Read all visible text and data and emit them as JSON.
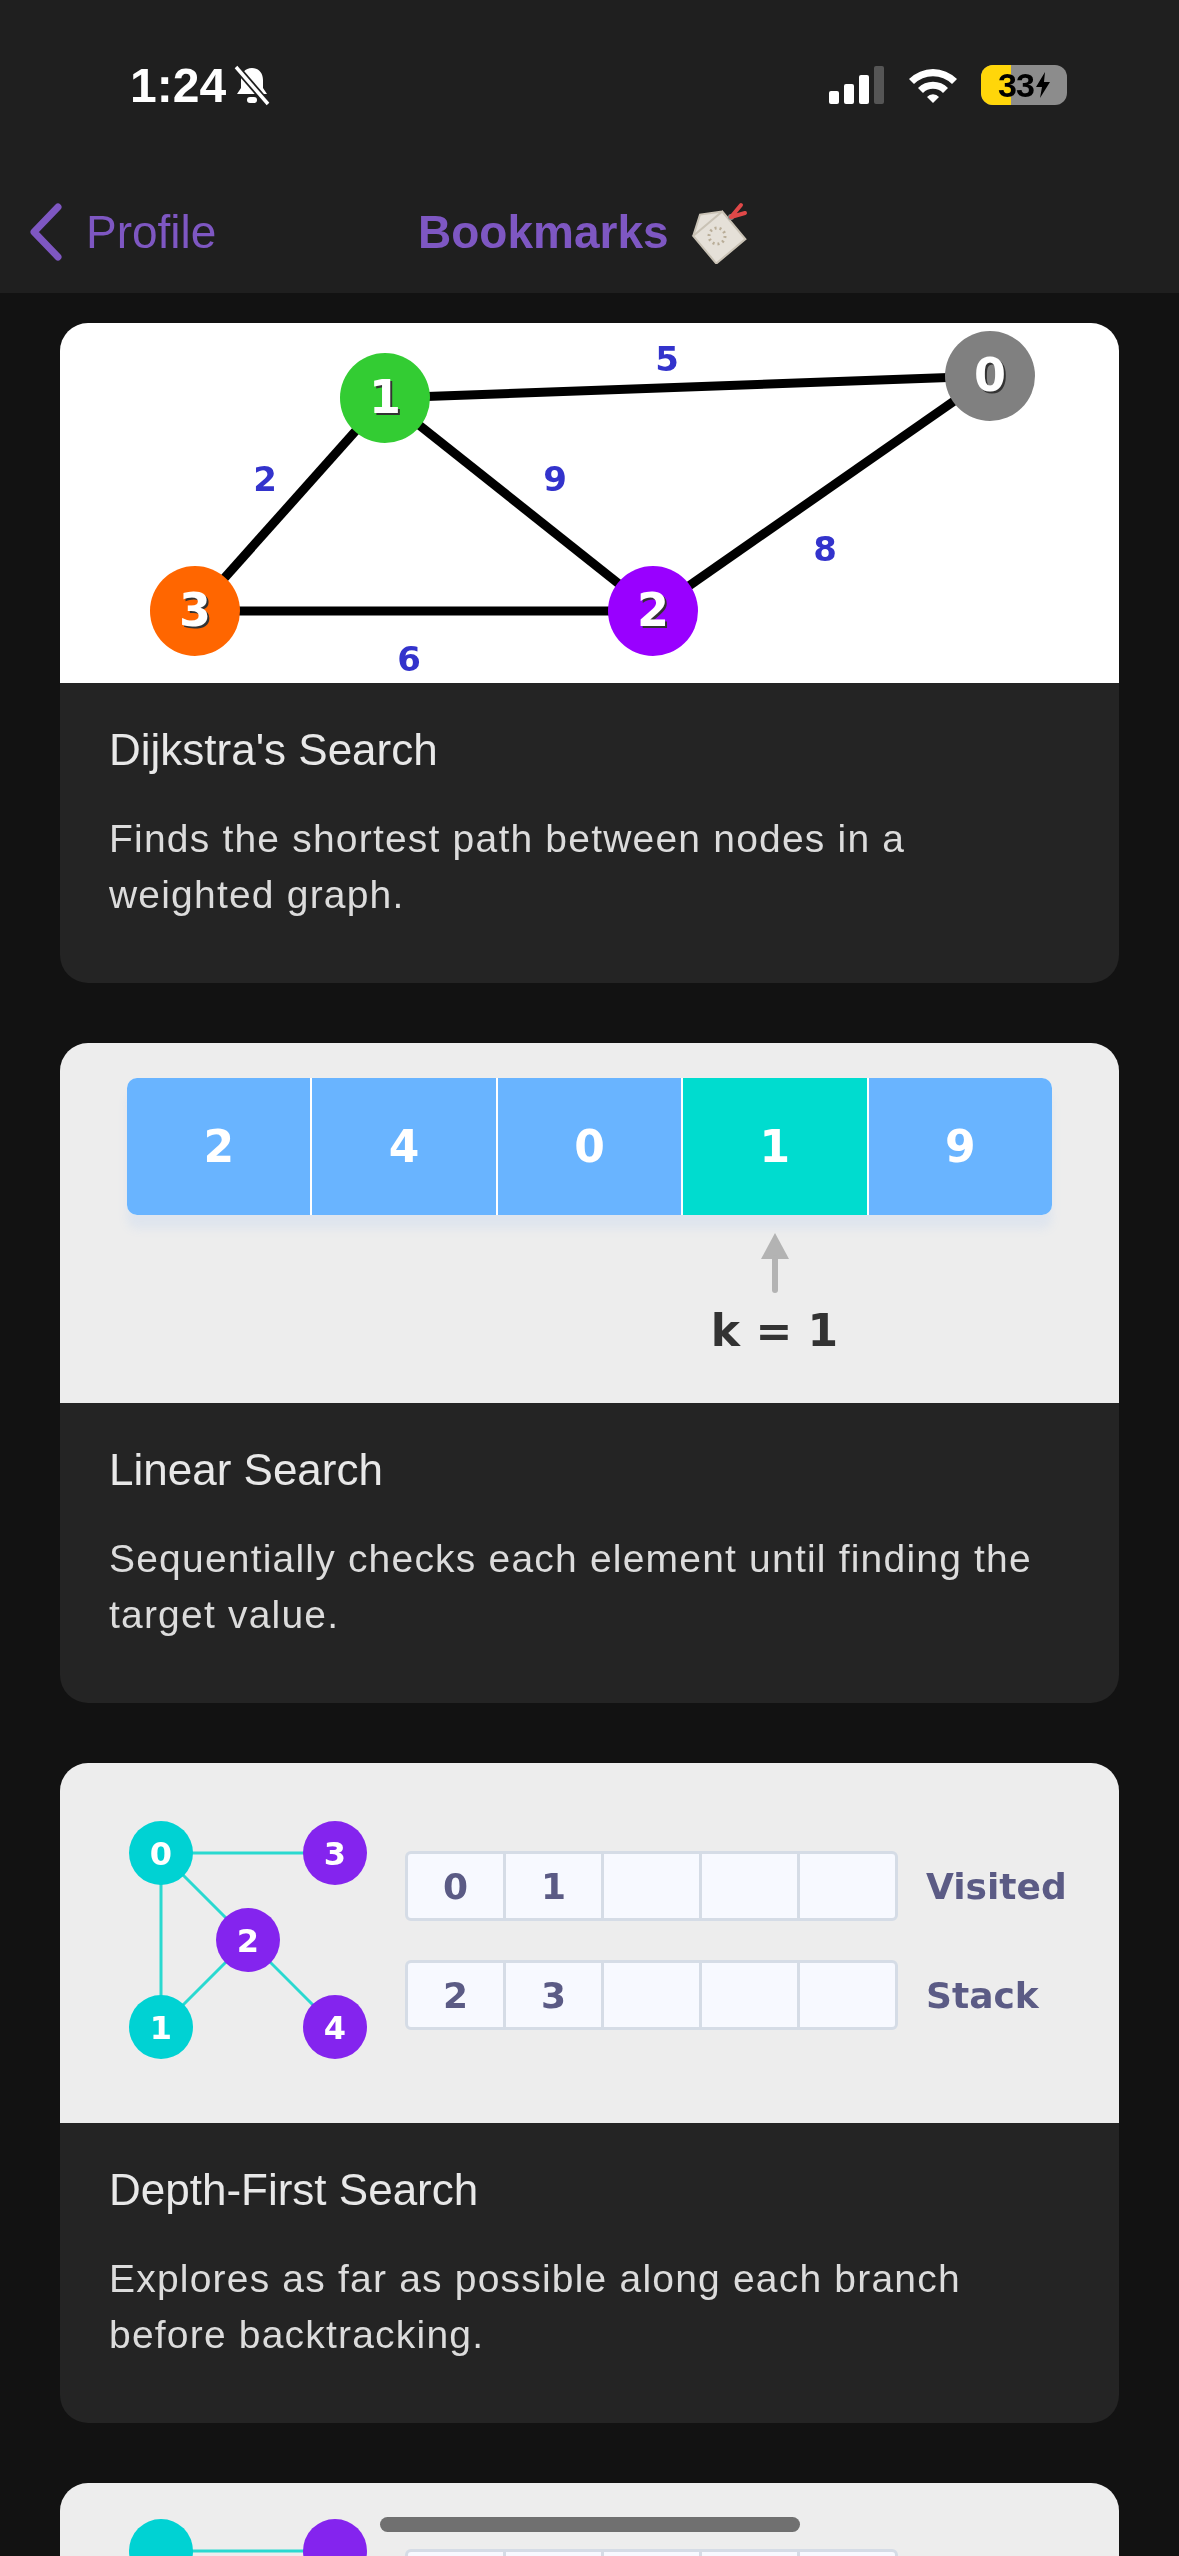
{
  "status_bar": {
    "time": "1:24",
    "battery": "33"
  },
  "nav": {
    "back": "Profile",
    "title": "Bookmarks"
  },
  "cards": [
    {
      "title": "Dijkstra's Search",
      "description": "Finds the shortest path between nodes in a weighted graph.",
      "image": {
        "kind": "weighted_graph",
        "nodes": [
          {
            "label": "1",
            "color": "#33cc33"
          },
          {
            "label": "0",
            "color": "#808080"
          },
          {
            "label": "3",
            "color": "#ff6600"
          },
          {
            "label": "2",
            "color": "#9900ff"
          }
        ],
        "edges": [
          {
            "weight": "5"
          },
          {
            "weight": "2"
          },
          {
            "weight": "9"
          },
          {
            "weight": "8"
          },
          {
            "weight": "6"
          }
        ]
      }
    },
    {
      "title": "Linear Search",
      "description": "Sequentially checks each element until finding the target value.",
      "image": {
        "kind": "array",
        "cells": [
          {
            "value": "2",
            "selected": false
          },
          {
            "value": "4",
            "selected": false
          },
          {
            "value": "0",
            "selected": false
          },
          {
            "value": "1",
            "selected": true
          },
          {
            "value": "9",
            "selected": false
          }
        ],
        "pointer": "k = 1"
      }
    },
    {
      "title": "Depth-First Search",
      "description": "Explores as far as possible along each branch before backtracking.",
      "image": {
        "kind": "dfs",
        "nodes": [
          {
            "label": "0",
            "color": "#00d2d3"
          },
          {
            "label": "3",
            "color": "#8424ee"
          },
          {
            "label": "2",
            "color": "#8424ee"
          },
          {
            "label": "1",
            "color": "#00d2d3"
          },
          {
            "label": "4",
            "color": "#8424ee"
          }
        ],
        "rows": [
          {
            "label": "Visited",
            "values": [
              "0",
              "1"
            ]
          },
          {
            "label": "Stack",
            "values": [
              "2",
              "3"
            ]
          }
        ]
      }
    },
    {
      "image": {
        "kind": "dfs_peek",
        "nodes": [
          {
            "color": "#00d2d3"
          },
          {
            "color": "#8424ee"
          }
        ]
      }
    }
  ]
}
